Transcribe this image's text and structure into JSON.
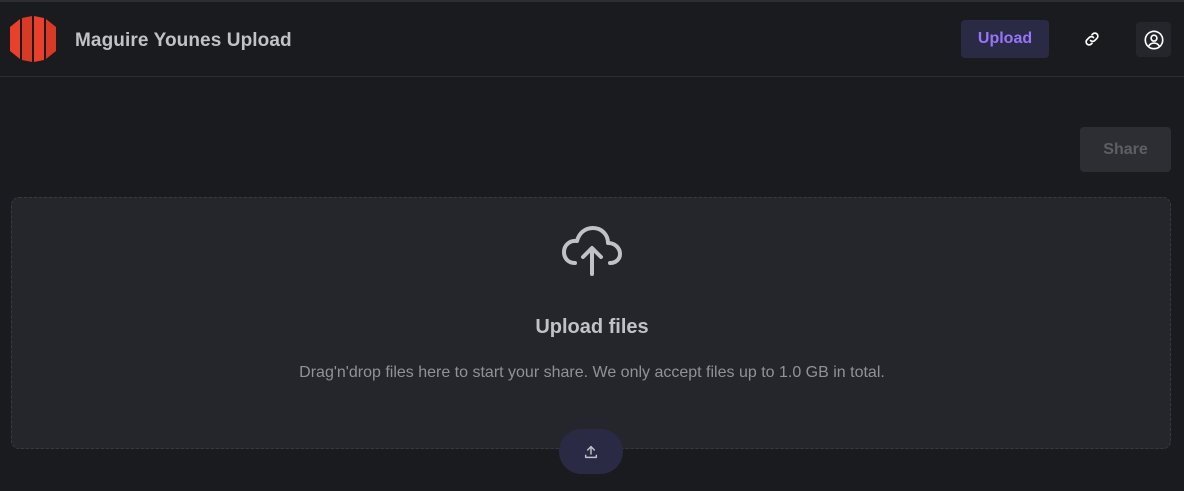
{
  "header": {
    "app_title": "Maguire Younes Upload",
    "nav_upload_label": "Upload",
    "link_icon": "link-icon",
    "user_icon": "user-circle-icon",
    "logo_icon": "hexagon-logo-icon"
  },
  "toolbar": {
    "share_label": "Share",
    "share_disabled": true
  },
  "dropzone": {
    "icon": "cloud-upload-icon",
    "title": "Upload files",
    "description": "Drag'n'drop files here to start your share. We only accept files up to 1.0 GB in total.",
    "button_icon": "upload-icon"
  },
  "colors": {
    "background": "#1a1b1e",
    "surface": "#25262b",
    "accent": "#9775fa",
    "accent_bg": "#2b2a45",
    "logo_red": "#e8402a"
  }
}
